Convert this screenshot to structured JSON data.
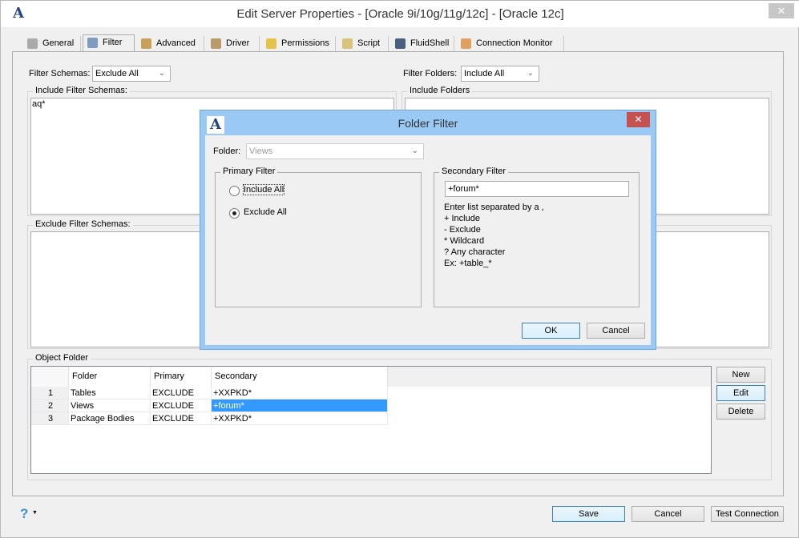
{
  "window": {
    "title": "Edit Server Properties - [Oracle 9i/10g/11g/12c] - [Oracle 12c]",
    "close": "✕",
    "logo": "A"
  },
  "tabs": [
    {
      "label": "General"
    },
    {
      "label": "Filter"
    },
    {
      "label": "Advanced"
    },
    {
      "label": "Driver"
    },
    {
      "label": "Permissions"
    },
    {
      "label": "Script"
    },
    {
      "label": "FluidShell"
    },
    {
      "label": "Connection Monitor"
    }
  ],
  "filter": {
    "schemas_label": "Filter Schemas:",
    "schemas_value": "Exclude All",
    "folders_label": "Filter Folders:",
    "folders_value": "Include All",
    "include_schemas_label": "Include Filter Schemas:",
    "include_schemas_value": "aq*",
    "include_folders_label": "Include Folders",
    "exclude_schemas_label": "Exclude Filter Schemas:"
  },
  "object_folder": {
    "label": "Object Folder",
    "columns": [
      "",
      "Folder",
      "Primary",
      "Secondary"
    ],
    "rows": [
      {
        "n": "1",
        "folder": "Tables",
        "primary": "EXCLUDE",
        "secondary": "+XXPKD*"
      },
      {
        "n": "2",
        "folder": "Views",
        "primary": "EXCLUDE",
        "secondary": "+forum*"
      },
      {
        "n": "3",
        "folder": "Package Bodies",
        "primary": "EXCLUDE",
        "secondary": "+XXPKD*"
      }
    ],
    "buttons": {
      "new": "New",
      "edit": "Edit",
      "delete": "Delete"
    }
  },
  "footer": {
    "help": "?",
    "save": "Save",
    "cancel": "Cancel",
    "test": "Test Connection"
  },
  "dialog": {
    "title": "Folder Filter",
    "close": "✕",
    "folder_label": "Folder:",
    "folder_value": "Views",
    "primary_label": "Primary Filter",
    "include_all": "Include All",
    "exclude_all": "Exclude All",
    "secondary_label": "Secondary Filter",
    "secondary_value": "+forum*",
    "help": [
      "Enter list separated by a ,",
      "+ Include",
      "- Exclude",
      "* Wildcard",
      "? Any character",
      "Ex: +table_*"
    ],
    "ok": "OK",
    "cancel": "Cancel"
  },
  "colors": {
    "selection": "#3399ff",
    "dialog_title": "#99c9f4",
    "close_red": "#c75050"
  }
}
